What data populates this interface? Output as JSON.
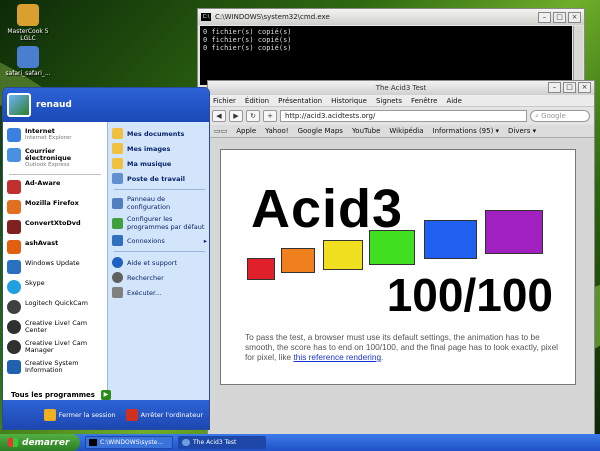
{
  "desktop": {
    "icons": [
      {
        "label": "MasterCook 5 LGLC",
        "icon": "mastercook-icon",
        "color": "#d9a030"
      },
      {
        "label": "safari_safari_...",
        "icon": "safari-shortcut-icon",
        "color": "#4a7fd0"
      }
    ]
  },
  "cmd_window": {
    "title": "C:\\WINDOWS\\system32\\cmd.exe",
    "lines": [
      "0 fichier(s) copié(s)",
      "0 fichier(s) copié(s)",
      "0 fichier(s) copié(s)"
    ]
  },
  "browser": {
    "title": "The Acid3 Test",
    "menu": [
      "Fichier",
      "Édition",
      "Présentation",
      "Historique",
      "Signets",
      "Fenêtre",
      "Aide"
    ],
    "url": "http://acid3.acidtests.org/",
    "search_placeholder": "Google",
    "bookmarks": [
      "Apple",
      "Yahoo!",
      "Google Maps",
      "YouTube",
      "Wikipédia",
      "Informations (95) ▾",
      "Divers ▾"
    ],
    "page": {
      "heading": "Acid3",
      "score": "100/100",
      "description": "To pass the test, a browser must use its default settings, the animation has to be smooth, the score has to end on 100/100, and the final page has to look exactly, pixel for pixel, like",
      "link": "this reference rendering",
      "period": ".",
      "boxes": [
        {
          "color": "#e0202a"
        },
        {
          "color": "#f0801e"
        },
        {
          "color": "#f0e020"
        },
        {
          "color": "#40e020"
        },
        {
          "color": "#2060f0"
        },
        {
          "color": "#a020c0"
        }
      ]
    }
  },
  "start_menu": {
    "user": "renaud",
    "pinned": [
      {
        "title": "Internet",
        "subtitle": "Internet Explorer",
        "icon": "internet-explorer-icon",
        "color": "#3a80e0"
      },
      {
        "title": "Courrier électronique",
        "subtitle": "Outlook Express",
        "icon": "outlook-icon",
        "color": "#4a90e0"
      }
    ],
    "recent": [
      {
        "label": "Ad-Aware",
        "icon": "ad-aware-icon",
        "color": "#c03030",
        "bold": true
      },
      {
        "label": "Mozilla Firefox",
        "icon": "firefox-icon",
        "color": "#e07020",
        "bold": true
      },
      {
        "label": "ConvertXtoDvd",
        "icon": "convertxtodvd-icon",
        "color": "#802020",
        "bold": true
      },
      {
        "label": "ashAvast",
        "icon": "avast-icon",
        "color": "#e06010",
        "bold": true
      },
      {
        "label": "Windows Update",
        "icon": "windows-update-icon",
        "color": "#2a70c0",
        "bold": false
      },
      {
        "label": "Skype",
        "icon": "skype-icon",
        "color": "#20a0e0",
        "bold": false
      },
      {
        "label": "Logitech QuickCam",
        "icon": "quickcam-icon",
        "color": "#404040",
        "bold": false
      },
      {
        "label": "Creative Live! Cam Center",
        "icon": "webcam-icon",
        "color": "#303030",
        "bold": false
      },
      {
        "label": "Creative Live! Cam Manager",
        "icon": "webcam-manager-icon",
        "color": "#303030",
        "bold": false
      },
      {
        "label": "Creative System Information",
        "icon": "system-info-icon",
        "color": "#2060b0",
        "bold": false
      }
    ],
    "all_programs": "Tous les programmes",
    "places": [
      {
        "label": "Mes documents",
        "icon": "folder-documents-icon",
        "color": "#f0c040",
        "bold": true
      },
      {
        "label": "Mes images",
        "icon": "folder-images-icon",
        "color": "#f0c040",
        "bold": true
      },
      {
        "label": "Ma musique",
        "icon": "folder-music-icon",
        "color": "#f0c040",
        "bold": true
      },
      {
        "label": "Poste de travail",
        "icon": "computer-icon",
        "color": "#6090d0",
        "bold": true
      }
    ],
    "system": [
      {
        "label": "Panneau de configuration",
        "icon": "control-panel-icon",
        "color": "#5080c0"
      },
      {
        "label": "Configurer les programmes par défaut",
        "icon": "default-programs-icon",
        "color": "#40a040"
      },
      {
        "label": "Connexions",
        "icon": "connections-icon",
        "color": "#3070c0",
        "arrow": "▸"
      }
    ],
    "help": [
      {
        "label": "Aide et support",
        "icon": "help-icon",
        "color": "#2060c0"
      },
      {
        "label": "Rechercher",
        "icon": "search-icon",
        "color": "#606060"
      },
      {
        "label": "Exécuter...",
        "icon": "run-icon",
        "color": "#808080"
      }
    ],
    "logoff": "Fermer la session",
    "shutdown": "Arrêter l'ordinateur"
  },
  "taskbar": {
    "start": "demarrer",
    "tasks": [
      {
        "label": "C:\\WINDOWS\\syste...",
        "active": false
      },
      {
        "label": "The Acid3 Test",
        "active": true
      }
    ]
  }
}
